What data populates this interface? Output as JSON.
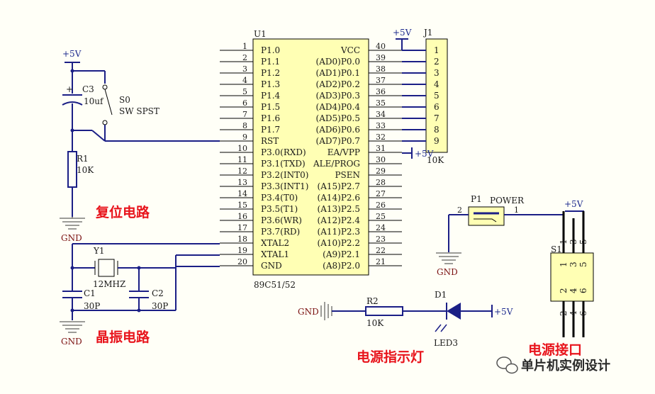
{
  "labels": {
    "u1": "U1",
    "chip_part": "89C51/52",
    "j1": "J1",
    "j1_value": "10K",
    "plus5v": "+5V",
    "gnd": "GND",
    "c3": "C3",
    "c3_value": "10uf",
    "s0": "S0",
    "s0_type": "SW SPST",
    "r1": "R1",
    "r1_value": "10K",
    "y1": "Y1",
    "y1_value": "12MHZ",
    "c1": "C1",
    "c1_value": "30P",
    "c2": "C2",
    "c2_value": "30P",
    "r2": "R2",
    "r2_value": "10K",
    "d1": "D1",
    "led": "LED3",
    "p1": "P1",
    "power": "POWER",
    "p1_pin2": "2",
    "p1_pin1": "1",
    "s1": "S1",
    "section_reset": "复位电路",
    "section_crystal": "晶振电路",
    "section_indicator": "电源指示灯",
    "section_power": "电源接口",
    "watermark": "单片机实例设计"
  },
  "chip_left": [
    {
      "num": "1",
      "name": "P1.0"
    },
    {
      "num": "2",
      "name": "P1.1"
    },
    {
      "num": "3",
      "name": "P1.2"
    },
    {
      "num": "4",
      "name": "P1.3"
    },
    {
      "num": "5",
      "name": "P1.4"
    },
    {
      "num": "6",
      "name": "P1.5"
    },
    {
      "num": "7",
      "name": "P1.6"
    },
    {
      "num": "8",
      "name": "P1.7"
    },
    {
      "num": "9",
      "name": "RST"
    },
    {
      "num": "10",
      "name": "P3.0(RXD)"
    },
    {
      "num": "11",
      "name": "P3.1(TXD)"
    },
    {
      "num": "12",
      "name": "P3.2(INT0)"
    },
    {
      "num": "13",
      "name": "P3.3(INT1)"
    },
    {
      "num": "14",
      "name": "P3.4(T0)"
    },
    {
      "num": "15",
      "name": "P3.5(T1)"
    },
    {
      "num": "16",
      "name": "P3.6(WR)"
    },
    {
      "num": "17",
      "name": "P3.7(RD)"
    },
    {
      "num": "18",
      "name": "XTAL2"
    },
    {
      "num": "19",
      "name": "XTAL1"
    },
    {
      "num": "20",
      "name": "GND"
    }
  ],
  "chip_right": [
    {
      "num": "40",
      "name": "VCC"
    },
    {
      "num": "39",
      "name": "(AD0)P0.0"
    },
    {
      "num": "38",
      "name": "(AD1)P0.1"
    },
    {
      "num": "37",
      "name": "(AD2)P0.2"
    },
    {
      "num": "36",
      "name": "(AD3)P0.3"
    },
    {
      "num": "35",
      "name": "(AD4)P0.4"
    },
    {
      "num": "34",
      "name": "(AD5)P0.5"
    },
    {
      "num": "33",
      "name": "(AD6)P0.6"
    },
    {
      "num": "32",
      "name": "(AD7)P0.7"
    },
    {
      "num": "31",
      "name": "EA/VPP"
    },
    {
      "num": "30",
      "name": "ALE/PROG"
    },
    {
      "num": "29",
      "name": "PSEN"
    },
    {
      "num": "28",
      "name": "(A15)P2.7"
    },
    {
      "num": "27",
      "name": "(A14)P2.6"
    },
    {
      "num": "26",
      "name": "(A13)P2.5"
    },
    {
      "num": "25",
      "name": "(A12)P2.4"
    },
    {
      "num": "24",
      "name": "(A11)P2.3"
    },
    {
      "num": "23",
      "name": "(A10)P2.2"
    },
    {
      "num": "22",
      "name": "(A9)P2.1"
    },
    {
      "num": "21",
      "name": "(A8)P2.0"
    }
  ],
  "j1_pins": [
    "1",
    "2",
    "3",
    "4",
    "5",
    "6",
    "7",
    "8",
    "9"
  ],
  "s1_pins": {
    "top": [
      "1",
      "3",
      "5"
    ],
    "bottom": [
      "2",
      "4",
      "6"
    ]
  },
  "colors": {
    "chip_fill": "#ffffb4",
    "wire": "#1b1f86",
    "section_label": "#e8141c"
  }
}
